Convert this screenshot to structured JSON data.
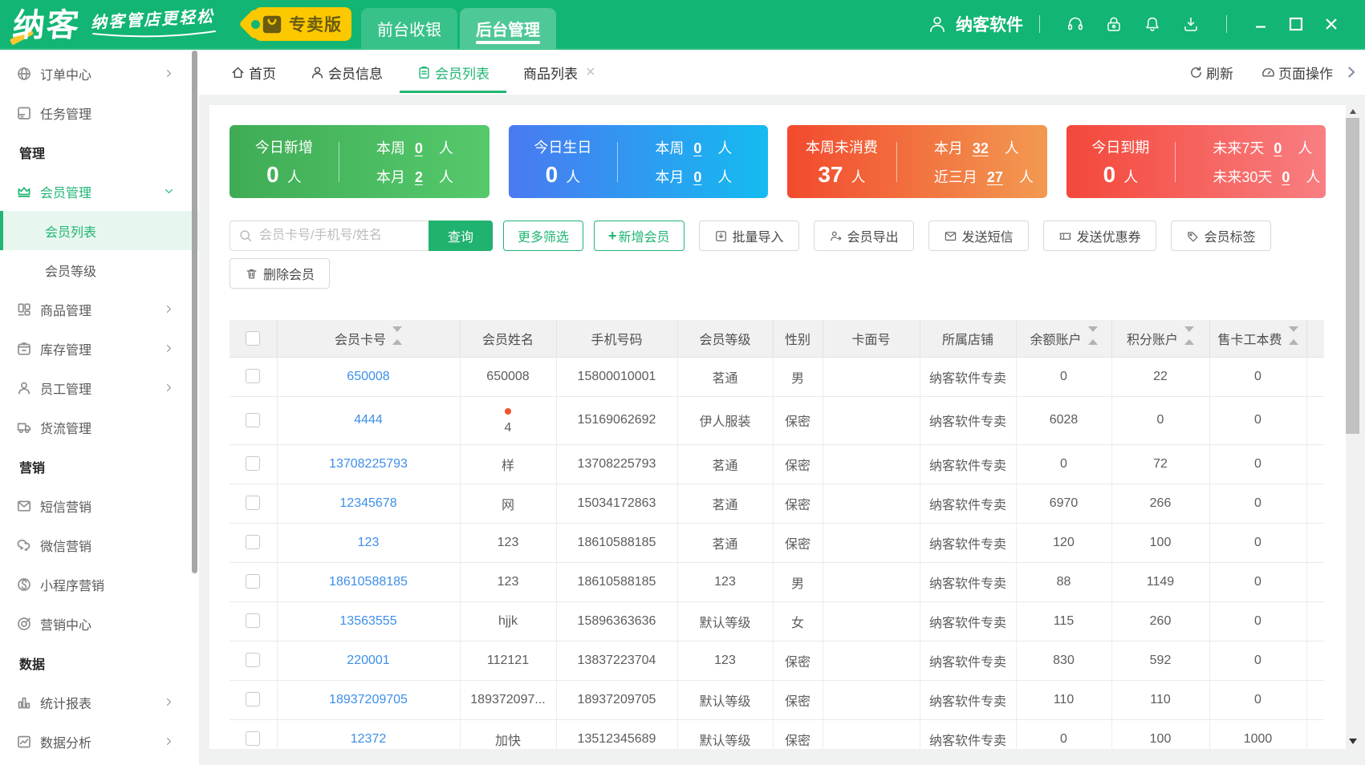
{
  "colors": {
    "brand_green": "#12b573",
    "accent_green": "#21b573",
    "link_blue": "#3d8fea",
    "badge_yellow": "#fcc800",
    "alert_red_dot": "#f4502a"
  },
  "topbar": {
    "brand": "纳客",
    "slogan": "纳客管店更轻松",
    "edition_badge": "专卖版",
    "nav_tabs": [
      {
        "label": "前台收银",
        "active": false
      },
      {
        "label": "后台管理",
        "active": true
      }
    ],
    "user_name": "纳客软件",
    "icons": [
      "headset",
      "lock",
      "bell",
      "download"
    ]
  },
  "sidebar": {
    "items": [
      {
        "label": "订单中心",
        "icon": "globe",
        "arrow": "right"
      },
      {
        "label": "任务管理",
        "icon": "tasks"
      },
      {
        "label": "管理",
        "type": "section"
      },
      {
        "label": "会员管理",
        "icon": "crown",
        "arrow": "down",
        "green": true
      },
      {
        "label": "会员列表",
        "type": "sub",
        "active": true
      },
      {
        "label": "会员等级",
        "type": "sub"
      },
      {
        "label": "商品管理",
        "icon": "goods",
        "arrow": "right"
      },
      {
        "label": "库存管理",
        "icon": "inventory",
        "arrow": "right"
      },
      {
        "label": "员工管理",
        "icon": "staff",
        "arrow": "right"
      },
      {
        "label": "货流管理",
        "icon": "truck"
      },
      {
        "label": "营销",
        "type": "section"
      },
      {
        "label": "短信营销",
        "icon": "envelope"
      },
      {
        "label": "微信营销",
        "icon": "wechat"
      },
      {
        "label": "小程序营销",
        "icon": "miniapp"
      },
      {
        "label": "营销中心",
        "icon": "target"
      },
      {
        "label": "数据",
        "type": "section"
      },
      {
        "label": "统计报表",
        "icon": "report",
        "arrow": "right"
      },
      {
        "label": "数据分析",
        "icon": "analysis",
        "arrow": "right"
      }
    ]
  },
  "tabbar": {
    "tabs": [
      {
        "label": "首页",
        "icon": "home"
      },
      {
        "label": "会员信息",
        "icon": "person"
      },
      {
        "label": "会员列表",
        "icon": "clipboard",
        "active": true
      },
      {
        "label": "商品列表",
        "closable": true
      }
    ],
    "close_glyph": "×",
    "refresh_label": "刷新",
    "page_actions_label": "页面操作"
  },
  "stats_cards": [
    {
      "title": "今日新增",
      "value": "0",
      "unit": "人",
      "gradient": [
        "#3fac55",
        "#55c96c"
      ],
      "rows": [
        {
          "label": "本周",
          "value": "0",
          "unit": "人"
        },
        {
          "label": "本月",
          "value": "2",
          "unit": "人"
        }
      ]
    },
    {
      "title": "今日生日",
      "value": "0",
      "unit": "人",
      "gradient": [
        "#4a79f1",
        "#14bbf0"
      ],
      "rows": [
        {
          "label": "本周",
          "value": "0",
          "unit": "人"
        },
        {
          "label": "本月",
          "value": "0",
          "unit": "人"
        }
      ]
    },
    {
      "title": "本周未消费",
      "value": "37",
      "unit": "人",
      "gradient": [
        "#f24a2e",
        "#f29a51"
      ],
      "rows": [
        {
          "label": "本月",
          "value": "32",
          "unit": "人"
        },
        {
          "label": "近三月",
          "value": "27",
          "unit": "人"
        }
      ]
    },
    {
      "title": "今日到期",
      "value": "0",
      "unit": "人",
      "gradient": [
        "#f4483a",
        "#f87e82"
      ],
      "rows": [
        {
          "label": "未来7天",
          "value": "0",
          "unit": "人"
        },
        {
          "label": "未来30天",
          "value": "0",
          "unit": "人"
        }
      ]
    }
  ],
  "toolbar": {
    "search_placeholder": "会员卡号/手机号/姓名",
    "search_button": "查询",
    "row1_buttons": [
      {
        "label": "更多筛选",
        "style": "green-outline"
      },
      {
        "label": "新增会员",
        "style": "green-outline",
        "icon": "plus"
      },
      {
        "label": "批量导入",
        "style": "default",
        "icon": "import"
      },
      {
        "label": "会员导出",
        "style": "default",
        "icon": "export"
      },
      {
        "label": "发送短信",
        "style": "default",
        "icon": "envelope"
      },
      {
        "label": "发送优惠券",
        "style": "default",
        "icon": "coupon"
      },
      {
        "label": "会员标签",
        "style": "default",
        "icon": "tag"
      }
    ],
    "row2_buttons": [
      {
        "label": "删除会员",
        "style": "default",
        "icon": "trash"
      }
    ]
  },
  "table": {
    "columns": [
      {
        "key": "card_no",
        "label": "会员卡号",
        "sortable": true
      },
      {
        "key": "name",
        "label": "会员姓名"
      },
      {
        "key": "phone",
        "label": "手机号码"
      },
      {
        "key": "level",
        "label": "会员等级"
      },
      {
        "key": "gender",
        "label": "性别"
      },
      {
        "key": "card_face",
        "label": "卡面号"
      },
      {
        "key": "store",
        "label": "所属店铺"
      },
      {
        "key": "balance",
        "label": "余额账户",
        "sortable": true
      },
      {
        "key": "points",
        "label": "积分账户",
        "sortable": true
      },
      {
        "key": "card_fee",
        "label": "售卡工本费",
        "sortable": true
      }
    ],
    "rows": [
      {
        "card_no": "650008",
        "name": "650008",
        "phone": "15800010001",
        "level": "茗通",
        "gender": "男",
        "card_face": "",
        "store": "纳客软件专卖",
        "balance": "0",
        "points": "22",
        "card_fee": "0"
      },
      {
        "card_no": "4444",
        "name": "4",
        "name_dot": true,
        "phone": "15169062692",
        "level": "伊人服装",
        "gender": "保密",
        "card_face": "",
        "store": "纳客软件专卖",
        "balance": "6028",
        "points": "0",
        "card_fee": "0"
      },
      {
        "card_no": "13708225793",
        "name": "样",
        "phone": "13708225793",
        "level": "茗通",
        "gender": "保密",
        "card_face": "",
        "store": "纳客软件专卖",
        "balance": "0",
        "points": "72",
        "card_fee": "0"
      },
      {
        "card_no": "12345678",
        "name": "网",
        "phone": "15034172863",
        "level": "茗通",
        "gender": "保密",
        "card_face": "",
        "store": "纳客软件专卖",
        "balance": "6970",
        "points": "266",
        "card_fee": "0"
      },
      {
        "card_no": "123",
        "name": "123",
        "phone": "18610588185",
        "level": "茗通",
        "gender": "保密",
        "card_face": "",
        "store": "纳客软件专卖",
        "balance": "120",
        "points": "100",
        "card_fee": "0"
      },
      {
        "card_no": "18610588185",
        "name": "123",
        "phone": "18610588185",
        "level": "123",
        "gender": "男",
        "card_face": "",
        "store": "纳客软件专卖",
        "balance": "88",
        "points": "1149",
        "card_fee": "0"
      },
      {
        "card_no": "13563555",
        "name": "hjjk",
        "phone": "15896363636",
        "level": "默认等级",
        "gender": "女",
        "card_face": "",
        "store": "纳客软件专卖",
        "balance": "115",
        "points": "260",
        "card_fee": "0"
      },
      {
        "card_no": "220001",
        "name": "112121",
        "phone": "13837223704",
        "level": "123",
        "gender": "保密",
        "card_face": "",
        "store": "纳客软件专卖",
        "balance": "830",
        "points": "592",
        "card_fee": "0"
      },
      {
        "card_no": "18937209705",
        "name": "189372097...",
        "phone": "18937209705",
        "level": "默认等级",
        "gender": "保密",
        "card_face": "",
        "store": "纳客软件专卖",
        "balance": "110",
        "points": "110",
        "card_fee": "0"
      },
      {
        "card_no": "12372",
        "name": "加快",
        "phone": "13512345689",
        "level": "默认等级",
        "gender": "保密",
        "card_face": "",
        "store": "纳客软件专卖",
        "balance": "0",
        "points": "100",
        "card_fee": "1000"
      }
    ]
  }
}
